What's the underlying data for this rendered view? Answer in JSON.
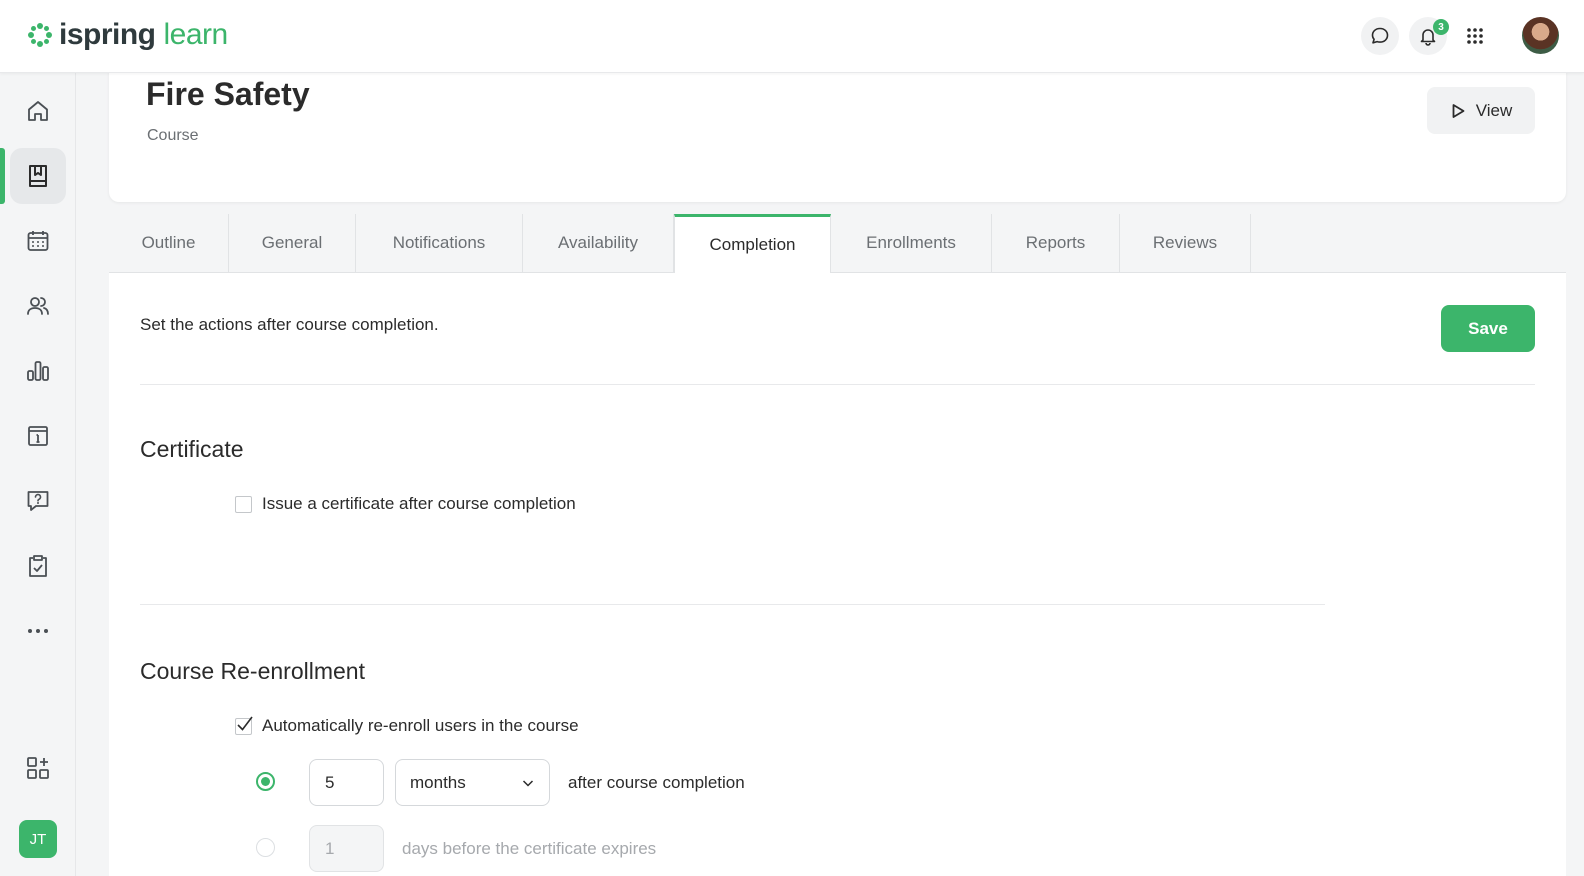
{
  "app": {
    "logo_part1": "ispring",
    "logo_part2": "learn",
    "brand_color": "#3cb56b"
  },
  "topbar": {
    "notification_count": "3"
  },
  "sidebar": {
    "items": [
      "home-icon",
      "course-book-icon",
      "calendar-icon",
      "users-icon",
      "reports-chart-icon",
      "info-board-icon",
      "question-chat-icon",
      "tasks-clipboard-icon",
      "more-dots-icon"
    ],
    "active_index": 1,
    "user_initials": "JT"
  },
  "header": {
    "title": "Fire Safety",
    "subtitle": "Course",
    "view_label": "View"
  },
  "tabs": [
    {
      "label": "Outline"
    },
    {
      "label": "General"
    },
    {
      "label": "Notifications"
    },
    {
      "label": "Availability"
    },
    {
      "label": "Completion",
      "active": true
    },
    {
      "label": "Enrollments"
    },
    {
      "label": "Reports"
    },
    {
      "label": "Reviews"
    }
  ],
  "content": {
    "intro": "Set the actions after course completion.",
    "save_label": "Save",
    "certificate": {
      "title": "Certificate",
      "issue_label": "Issue a certificate after course completion",
      "issue_checked": false
    },
    "reenroll": {
      "title": "Course Re-enrollment",
      "auto_label": "Automatically re-enroll users in the course",
      "auto_checked": true,
      "option1": {
        "value": "5",
        "unit": "months",
        "suffix": "after course completion",
        "selected": true
      },
      "option2": {
        "value": "1",
        "suffix": "days before the certificate expires",
        "selected": false
      }
    }
  }
}
